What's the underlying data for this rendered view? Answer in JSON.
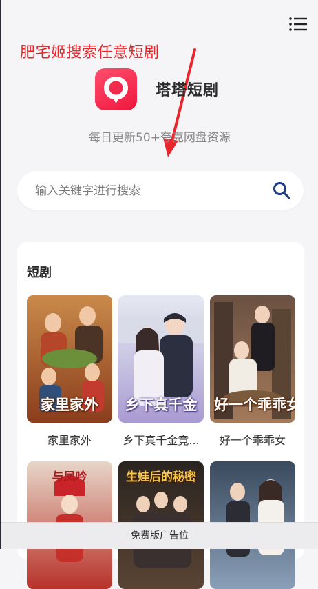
{
  "annotation": "肥宅姬搜索任意短剧",
  "app": {
    "name": "塔塔短剧",
    "tagline": "每日更新50+夸克网盘资源"
  },
  "search": {
    "placeholder": "输入关键字进行搜索"
  },
  "section": {
    "title": "短剧",
    "items": [
      {
        "title": "家里家外",
        "overlay": "家里家外"
      },
      {
        "title": "乡下真千金竟...",
        "overlay": "乡下真千金"
      },
      {
        "title": "好一个乖乖女",
        "overlay": "好一个乖乖女"
      },
      {
        "overlay": "与凤吟"
      },
      {
        "overlay": "生娃后的秘密"
      },
      {
        "overlay": ""
      }
    ]
  },
  "ad": {
    "label": "免费版广告位"
  },
  "colors": {
    "accent": "#e8262b",
    "brand": "#f0163d",
    "search_icon": "#1e3c8c"
  },
  "icons": {
    "menu": "menu-icon",
    "search": "search-icon",
    "logo": "location-pin-logo"
  }
}
